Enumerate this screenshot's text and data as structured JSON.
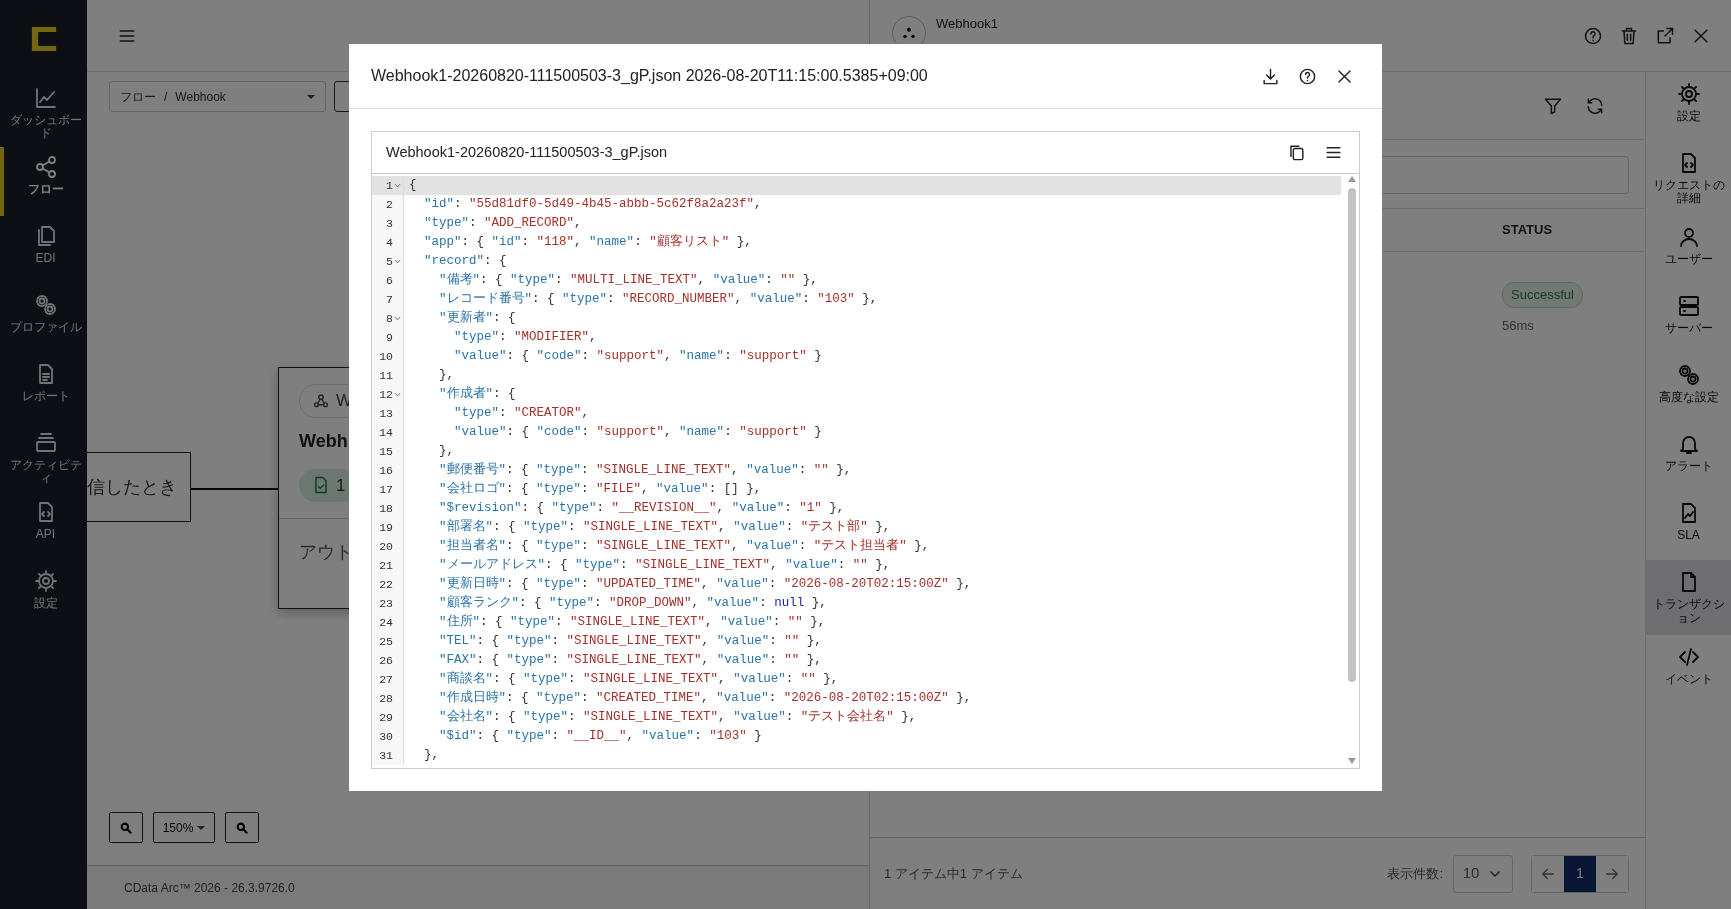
{
  "sidebar": {
    "items": [
      {
        "label": "ダッシュボード",
        "selected": false
      },
      {
        "label": "フロー",
        "selected": true
      },
      {
        "label": "EDI",
        "selected": false
      },
      {
        "label": "プロファイル",
        "selected": false
      },
      {
        "label": "レポート",
        "selected": false
      },
      {
        "label": "アクティビティ",
        "selected": false
      },
      {
        "label": "API",
        "selected": false
      },
      {
        "label": "設定",
        "selected": false
      }
    ]
  },
  "breadcrumb": {
    "items": [
      "フロー",
      "Webhook"
    ],
    "separator": "/"
  },
  "canvas": {
    "trigger_node": {
      "label": "信したとき"
    },
    "flow_node": {
      "tag": "W",
      "title": "Webh",
      "badge": "1",
      "section": "アウト"
    }
  },
  "zoom": {
    "label": "150%"
  },
  "footer": {
    "text": "CData Arc™ 2026 - 26.3.9726.0"
  },
  "panel": {
    "title": "Webhook1",
    "table": {
      "columns": [
        "STATUS"
      ],
      "rows": [
        {
          "status": "Successful",
          "duration": "56ms"
        }
      ]
    },
    "footer": {
      "summary": "1 アイテム中1 アイテム",
      "page_size_label": "表示件数:",
      "page_size": "10",
      "pages": [
        {
          "label": "1",
          "selected": true
        }
      ]
    }
  },
  "right_bar": {
    "items": [
      {
        "label": "設定",
        "selected": false
      },
      {
        "label": "リクエストの詳細",
        "selected": false
      },
      {
        "label": "ユーザー",
        "selected": false
      },
      {
        "label": "サーバー",
        "selected": false
      },
      {
        "label": "高度な設定",
        "selected": false
      },
      {
        "label": "アラート",
        "selected": false
      },
      {
        "label": "SLA",
        "selected": false
      },
      {
        "label": "トランザクション",
        "selected": true
      },
      {
        "label": "イベント",
        "selected": false
      }
    ]
  },
  "modal": {
    "title": "Webhook1-20260820-111500503-3_gP.json 2026-08-20T11:15:00.5385+09:00",
    "file": {
      "name": "Webhook1-20260820-111500503-3_gP.json",
      "lines": [
        {
          "number": "1",
          "text": "{",
          "foldable": true,
          "current": true
        },
        {
          "number": "2",
          "text": "  \"id\": \"55d81df0-5d49-4b45-abbb-5c62f8a2a23f\",",
          "foldable": false,
          "current": false
        },
        {
          "number": "3",
          "text": "  \"type\": \"ADD_RECORD\",",
          "foldable": false,
          "current": false
        },
        {
          "number": "4",
          "text": "  \"app\": { \"id\": \"118\", \"name\": \"顧客リスト\" },",
          "foldable": false,
          "current": false
        },
        {
          "number": "5",
          "text": "  \"record\": {",
          "foldable": true,
          "current": false
        },
        {
          "number": "6",
          "text": "    \"備考\": { \"type\": \"MULTI_LINE_TEXT\", \"value\": \"\" },",
          "foldable": false,
          "current": false
        },
        {
          "number": "7",
          "text": "    \"レコード番号\": { \"type\": \"RECORD_NUMBER\", \"value\": \"103\" },",
          "foldable": false,
          "current": false
        },
        {
          "number": "8",
          "text": "    \"更新者\": {",
          "foldable": true,
          "current": false
        },
        {
          "number": "9",
          "text": "      \"type\": \"MODIFIER\",",
          "foldable": false,
          "current": false
        },
        {
          "number": "10",
          "text": "      \"value\": { \"code\": \"support\", \"name\": \"support\" }",
          "foldable": false,
          "current": false
        },
        {
          "number": "11",
          "text": "    },",
          "foldable": false,
          "current": false
        },
        {
          "number": "12",
          "text": "    \"作成者\": {",
          "foldable": true,
          "current": false
        },
        {
          "number": "13",
          "text": "      \"type\": \"CREATOR\",",
          "foldable": false,
          "current": false
        },
        {
          "number": "14",
          "text": "      \"value\": { \"code\": \"support\", \"name\": \"support\" }",
          "foldable": false,
          "current": false
        },
        {
          "number": "15",
          "text": "    },",
          "foldable": false,
          "current": false
        },
        {
          "number": "16",
          "text": "    \"郵便番号\": { \"type\": \"SINGLE_LINE_TEXT\", \"value\": \"\" },",
          "foldable": false,
          "current": false
        },
        {
          "number": "17",
          "text": "    \"会社ロゴ\": { \"type\": \"FILE\", \"value\": [] },",
          "foldable": false,
          "current": false
        },
        {
          "number": "18",
          "text": "    \"$revision\": { \"type\": \"__REVISION__\", \"value\": \"1\" },",
          "foldable": false,
          "current": false
        },
        {
          "number": "19",
          "text": "    \"部署名\": { \"type\": \"SINGLE_LINE_TEXT\", \"value\": \"テスト部\" },",
          "foldable": false,
          "current": false
        },
        {
          "number": "20",
          "text": "    \"担当者名\": { \"type\": \"SINGLE_LINE_TEXT\", \"value\": \"テスト担当者\" },",
          "foldable": false,
          "current": false
        },
        {
          "number": "21",
          "text": "    \"メールアドレス\": { \"type\": \"SINGLE_LINE_TEXT\", \"value\": \"\" },",
          "foldable": false,
          "current": false
        },
        {
          "number": "22",
          "text": "    \"更新日時\": { \"type\": \"UPDATED_TIME\", \"value\": \"2026-08-20T02:15:00Z\" },",
          "foldable": false,
          "current": false
        },
        {
          "number": "23",
          "text": "    \"顧客ランク\": { \"type\": \"DROP_DOWN\", \"value\": null },",
          "foldable": false,
          "current": false
        },
        {
          "number": "24",
          "text": "    \"住所\": { \"type\": \"SINGLE_LINE_TEXT\", \"value\": \"\" },",
          "foldable": false,
          "current": false
        },
        {
          "number": "25",
          "text": "    \"TEL\": { \"type\": \"SINGLE_LINE_TEXT\", \"value\": \"\" },",
          "foldable": false,
          "current": false
        },
        {
          "number": "26",
          "text": "    \"FAX\": { \"type\": \"SINGLE_LINE_TEXT\", \"value\": \"\" },",
          "foldable": false,
          "current": false
        },
        {
          "number": "27",
          "text": "    \"商談名\": { \"type\": \"SINGLE_LINE_TEXT\", \"value\": \"\" },",
          "foldable": false,
          "current": false
        },
        {
          "number": "28",
          "text": "    \"作成日時\": { \"type\": \"CREATED_TIME\", \"value\": \"2026-08-20T02:15:00Z\" },",
          "foldable": false,
          "current": false
        },
        {
          "number": "29",
          "text": "    \"会社名\": { \"type\": \"SINGLE_LINE_TEXT\", \"value\": \"テスト会社名\" },",
          "foldable": false,
          "current": false
        },
        {
          "number": "30",
          "text": "    \"$id\": { \"type\": \"__ID__\", \"value\": \"103\" }",
          "foldable": false,
          "current": false
        },
        {
          "number": "31",
          "text": "  },",
          "foldable": false,
          "current": false
        }
      ]
    }
  }
}
